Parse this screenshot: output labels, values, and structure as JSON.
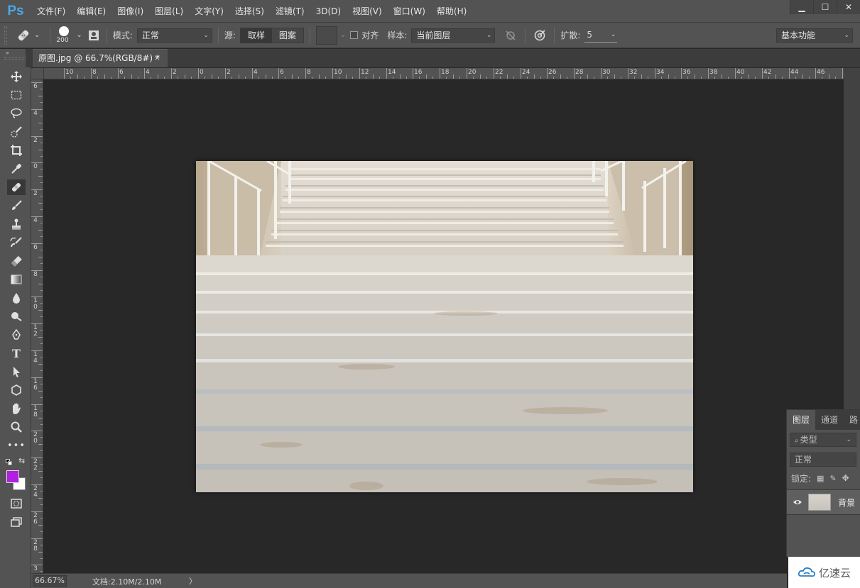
{
  "app": {
    "logo": "Ps",
    "menu": [
      "文件(F)",
      "编辑(E)",
      "图像(I)",
      "图层(L)",
      "文字(Y)",
      "选择(S)",
      "滤镜(T)",
      "3D(D)",
      "视图(V)",
      "窗口(W)",
      "帮助(H)"
    ],
    "window_buttons": [
      "▁",
      "☐",
      "✕"
    ]
  },
  "options": {
    "brush_size": "200",
    "mode_label": "模式:",
    "mode_value": "正常",
    "source_label": "源:",
    "source_options": [
      "取样",
      "图案"
    ],
    "source_selected": "取样",
    "align_label": "对齐",
    "sample_label": "样本:",
    "sample_value": "当前图层",
    "diffusion_label": "扩散:",
    "diffusion_value": "5",
    "workspace": "基本功能"
  },
  "document": {
    "tab_title": "原图.jpg @ 66.7%(RGB/8#) *",
    "close": "×"
  },
  "rulers": {
    "horizontal": [
      "10",
      "8",
      "6",
      "4",
      "2",
      "0",
      "2",
      "4",
      "6",
      "8",
      "10",
      "12",
      "14",
      "16",
      "18",
      "20",
      "22",
      "24",
      "26",
      "28",
      "30",
      "32",
      "34",
      "36",
      "38",
      "40",
      "42",
      "44",
      "46",
      "4"
    ],
    "vertical": [
      "6",
      "4",
      "2",
      "0",
      "2",
      "4",
      "6",
      "8",
      "10",
      "12",
      "14",
      "16",
      "18",
      "20",
      "22",
      "24",
      "26",
      "28",
      "3"
    ]
  },
  "status": {
    "zoom": "66.67%",
    "doc_info": "文档:2.10M/2.10M",
    "arrow": "〉"
  },
  "layers_panel": {
    "tabs": [
      "图层",
      "通道",
      "路"
    ],
    "filter_placeholder": "类型",
    "blend_mode": "正常",
    "lock_label": "锁定:",
    "layer_name": "背景"
  },
  "colors": {
    "foreground": "#b21fe0",
    "background": "#ffffff",
    "accent": "#4aa8e8"
  },
  "watermark": {
    "text": "亿速云"
  },
  "tools": [
    "move-tool",
    "marquee-tool",
    "lasso-tool",
    "quick-select-tool",
    "crop-tool",
    "eyedropper-tool",
    "healing-brush-tool",
    "brush-tool",
    "clone-stamp-tool",
    "history-brush-tool",
    "eraser-tool",
    "gradient-tool",
    "blur-tool",
    "dodge-tool",
    "pen-tool",
    "type-tool",
    "path-select-tool",
    "shape-tool",
    "hand-tool",
    "zoom-tool",
    "more-tools"
  ]
}
